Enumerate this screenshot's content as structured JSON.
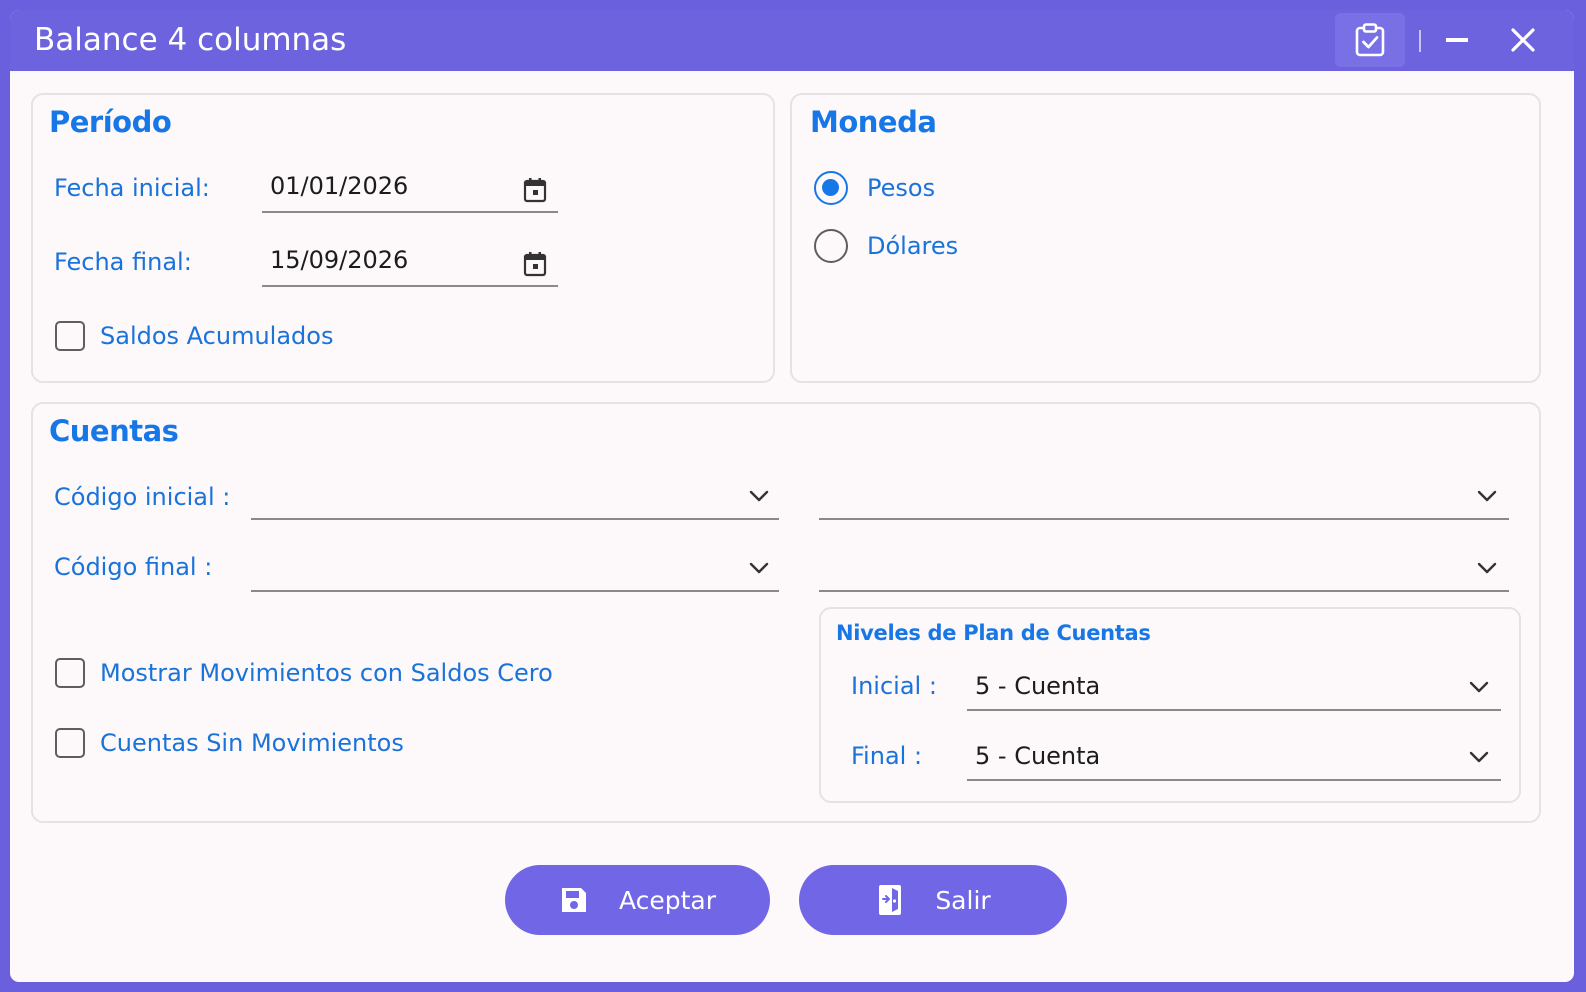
{
  "window": {
    "title": "Balance 4 columnas"
  },
  "periodo": {
    "title": "Período",
    "fecha_inicial": {
      "label": "Fecha inicial:",
      "value": "01/01/2026"
    },
    "fecha_final": {
      "label": "Fecha final:",
      "value": "15/09/2026"
    },
    "saldos_acumulados": {
      "label": "Saldos Acumulados",
      "checked": false
    }
  },
  "moneda": {
    "title": "Moneda",
    "options": [
      {
        "label": "Pesos",
        "selected": true
      },
      {
        "label": "Dólares",
        "selected": false
      }
    ]
  },
  "cuentas": {
    "title": "Cuentas",
    "codigo_inicial": {
      "label": "Código inicial :",
      "value": "",
      "description": ""
    },
    "codigo_final": {
      "label": "Código final :",
      "value": "",
      "description": ""
    },
    "mostrar_movimientos": {
      "label": "Mostrar Movimientos con Saldos Cero",
      "checked": false
    },
    "sin_movimientos": {
      "label": "Cuentas Sin Movimientos",
      "checked": false
    },
    "niveles": {
      "title": "Niveles de Plan de Cuentas",
      "inicial": {
        "label": "Inicial :",
        "value": "5 - Cuenta"
      },
      "final": {
        "label": "Final :",
        "value": "5 - Cuenta"
      }
    }
  },
  "buttons": {
    "aceptar": "Aceptar",
    "salir": "Salir"
  },
  "colors": {
    "accent": "#6e63df",
    "label_blue": "#1a73d9",
    "title_blue": "#1877e6",
    "button": "#7167e6"
  },
  "icons": {
    "titlebar": [
      "clipboard-check-icon",
      "minimize-icon",
      "close-icon"
    ],
    "date": "calendar-icon",
    "dropdown": "chevron-down-icon",
    "aceptar": "save-icon",
    "salir": "exit-door-icon"
  }
}
